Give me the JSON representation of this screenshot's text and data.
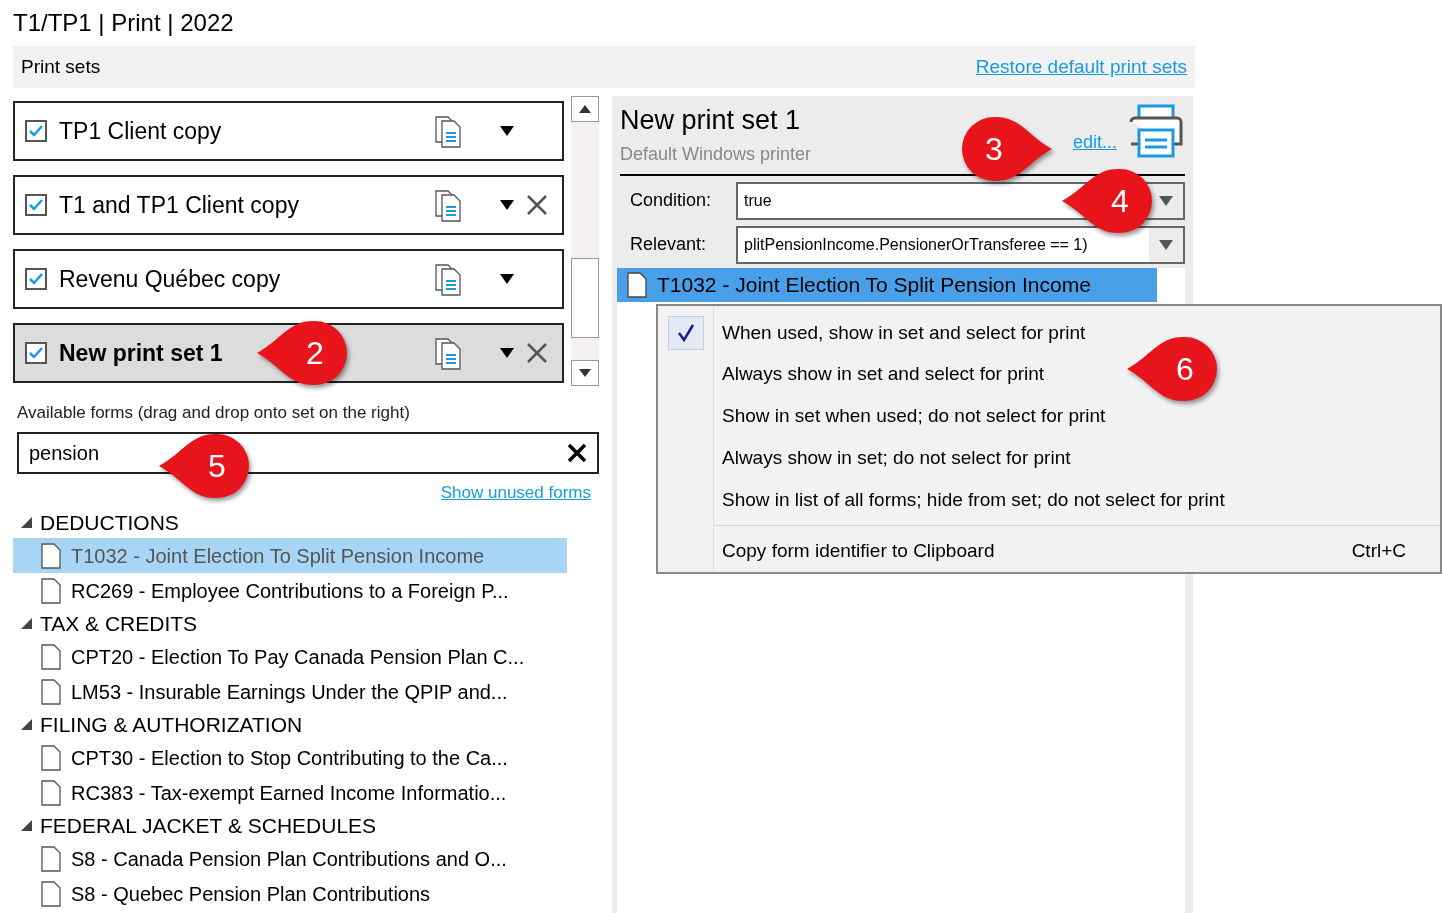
{
  "window": {
    "title": "T1/TP1 | Print | 2022"
  },
  "header": {
    "label": "Print sets",
    "link": "Restore default print sets"
  },
  "print_sets": [
    {
      "name": "TP1 Client copy",
      "checked": true,
      "selected": false,
      "removable": false
    },
    {
      "name": "T1 and TP1 Client copy",
      "checked": true,
      "selected": false,
      "removable": true
    },
    {
      "name": "Revenu Québec copy",
      "checked": true,
      "selected": false,
      "removable": false
    },
    {
      "name": "New print set 1",
      "checked": true,
      "selected": true,
      "removable": true
    }
  ],
  "available_forms": {
    "label": "Available forms (drag and drop onto set on the right)",
    "search": {
      "value": "pension"
    },
    "link": "Show unused forms",
    "groups": [
      {
        "name": "DEDUCTIONS",
        "expanded": true,
        "children": [
          {
            "name": "T1032 - Joint Election To Split Pension Income",
            "selected": true
          },
          {
            "name": "RC269 - Employee Contributions to a Foreign P...",
            "selected": false
          }
        ]
      },
      {
        "name": "TAX & CREDITS",
        "expanded": true,
        "children": [
          {
            "name": "CPT20 - Election To Pay Canada Pension Plan C...",
            "selected": false
          },
          {
            "name": "LM53 - Insurable Earnings Under the QPIP and...",
            "selected": false
          }
        ]
      },
      {
        "name": "FILING & AUTHORIZATION",
        "expanded": true,
        "children": [
          {
            "name": "CPT30 - Election to Stop Contributing to the Ca...",
            "selected": false
          },
          {
            "name": "RC383 - Tax-exempt Earned Income Informatio...",
            "selected": false
          }
        ]
      },
      {
        "name": "FEDERAL JACKET & SCHEDULES",
        "expanded": true,
        "children": [
          {
            "name": "S8 - Canada Pension Plan Contributions and O...",
            "selected": false
          },
          {
            "name": "S8 - Quebec Pension Plan Contributions",
            "selected": false
          }
        ]
      }
    ]
  },
  "detail": {
    "title": "New print set 1",
    "printer": "Default Windows printer",
    "edit_link": "edit...",
    "condition": {
      "label": "Condition:",
      "value": "true"
    },
    "relevant": {
      "label": "Relevant:",
      "value": "plitPensionIncome.PensionerOrTransferee == 1)"
    },
    "forms": [
      {
        "name": "T1032 - Joint Election To Split Pension Income",
        "selected": true
      }
    ]
  },
  "context_menu": {
    "items": [
      {
        "kind": "option",
        "label": "When used, show in set and select for print",
        "checked": true
      },
      {
        "kind": "option",
        "label": "Always show in set and select for print",
        "checked": false
      },
      {
        "kind": "option",
        "label": "Show in set when used; do not select for print",
        "checked": false
      },
      {
        "kind": "option",
        "label": "Always show in set; do not select for print",
        "checked": false
      },
      {
        "kind": "option",
        "label": "Show in list of all forms; hide from set; do not select for print",
        "checked": false
      },
      {
        "kind": "action",
        "label": "Copy form identifier to Clipboard",
        "shortcut": "Ctrl+C"
      }
    ]
  },
  "callouts": [
    "2",
    "3",
    "4",
    "5",
    "6"
  ]
}
